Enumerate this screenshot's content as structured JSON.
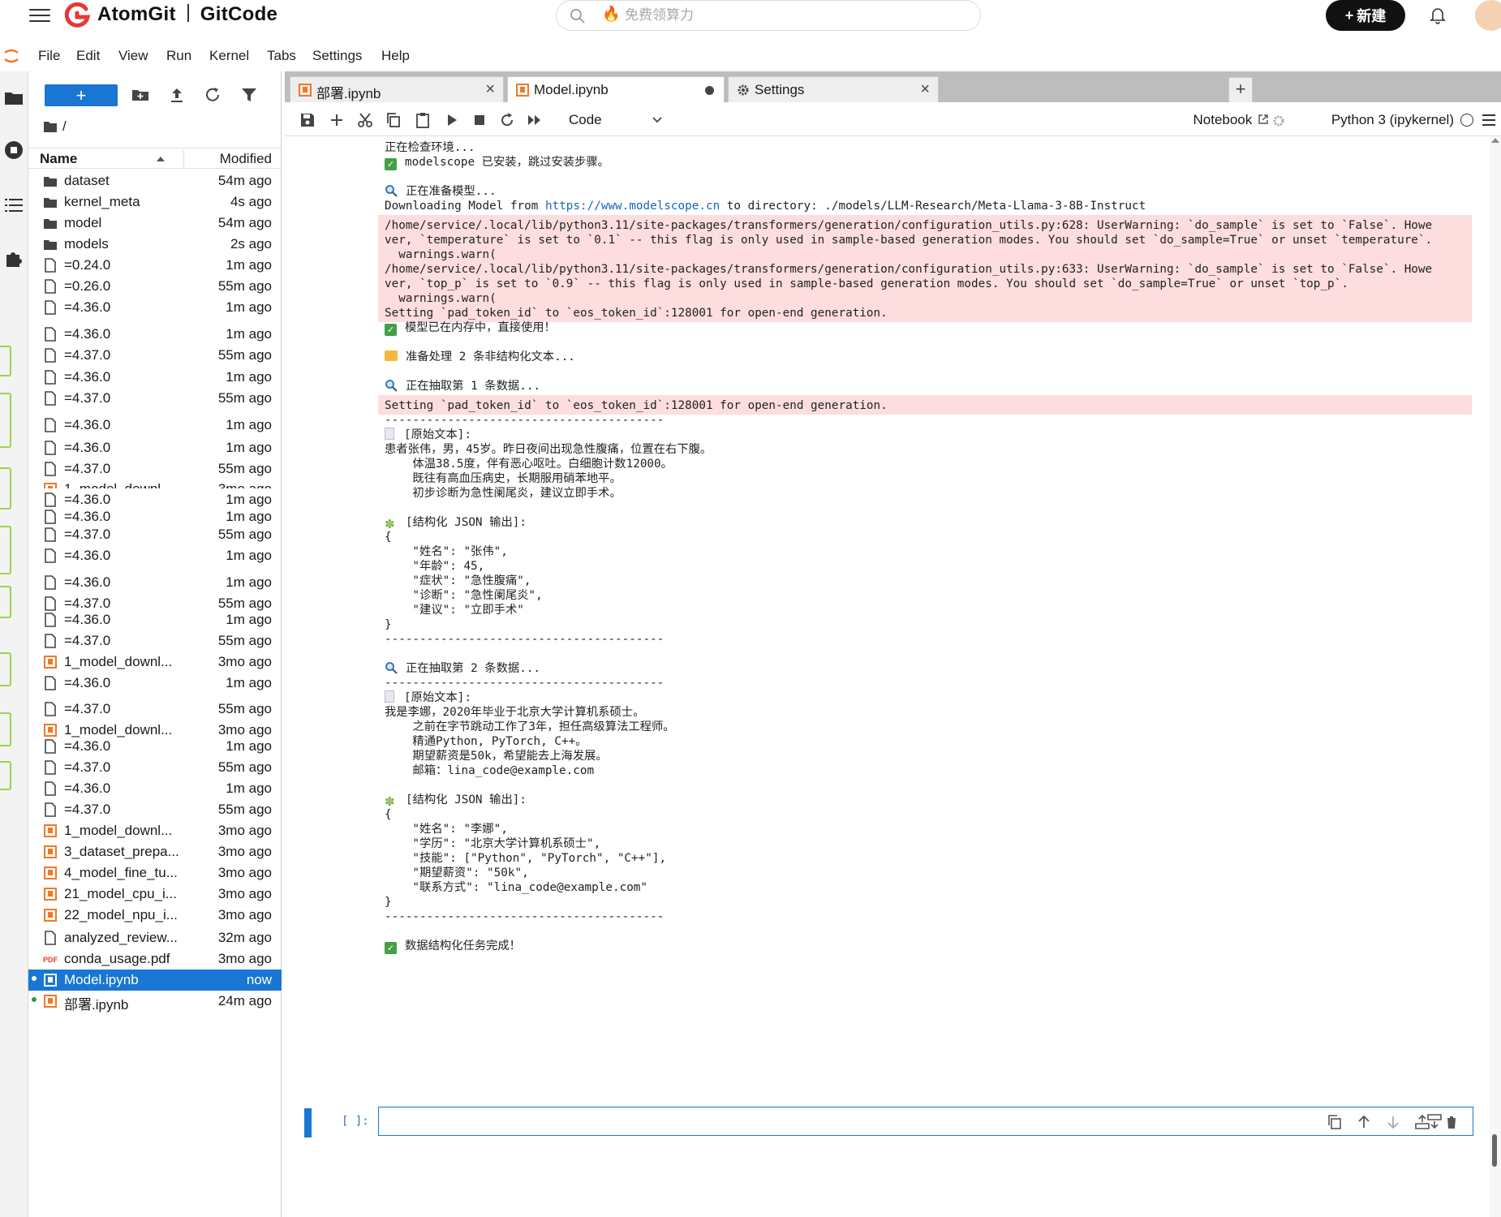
{
  "site": {
    "brand_left": "AtomGit",
    "brand_right": "GitCode",
    "search_placeholder": "免费领算力",
    "new_button": "新建"
  },
  "menu": [
    "File",
    "Edit",
    "View",
    "Run",
    "Kernel",
    "Tabs",
    "Settings",
    "Help"
  ],
  "file_browser": {
    "breadcrumb": "/",
    "col_name": "Name",
    "col_modified": "Modified",
    "rows": [
      {
        "name": "dataset",
        "modified": "54m ago",
        "type": "folder"
      },
      {
        "name": "kernel_meta",
        "modified": "4s ago",
        "type": "folder"
      },
      {
        "name": "model",
        "modified": "54m ago",
        "type": "folder"
      },
      {
        "name": "models",
        "modified": "2s ago",
        "type": "folder"
      },
      {
        "name": "=0.24.0",
        "modified": "1m ago",
        "type": "file"
      },
      {
        "name": "=0.26.0",
        "modified": "55m ago",
        "type": "file"
      },
      {
        "name": "=4.36.0",
        "modified": "1m ago",
        "type": "file"
      },
      {
        "name": "=4.36.0",
        "modified": "1m ago",
        "type": "file"
      },
      {
        "name": "=4.37.0",
        "modified": "55m ago",
        "type": "file"
      },
      {
        "name": "=4.36.0",
        "modified": "1m ago",
        "type": "file"
      },
      {
        "name": "=4.37.0",
        "modified": "55m ago",
        "type": "file"
      },
      {
        "name": "=4.36.0",
        "modified": "1m ago",
        "type": "file"
      },
      {
        "name": "=4.36.0",
        "modified": "1m ago",
        "type": "file"
      },
      {
        "name": "=4.37.0",
        "modified": "55m ago",
        "type": "file"
      },
      {
        "name": "1_model_downl...",
        "modified": "3mo ago",
        "type": "notebook"
      },
      {
        "name": "=4.36.0",
        "modified": "1m ago",
        "type": "file"
      },
      {
        "name": "=4.36.0",
        "modified": "1m ago",
        "type": "file"
      },
      {
        "name": "=4.37.0",
        "modified": "55m ago",
        "type": "file"
      },
      {
        "name": "=4.36.0",
        "modified": "1m ago",
        "type": "file"
      },
      {
        "name": "=4.36.0",
        "modified": "1m ago",
        "type": "file"
      },
      {
        "name": "=4.37.0",
        "modified": "55m ago",
        "type": "file"
      },
      {
        "name": "=4.36.0",
        "modified": "1m ago",
        "type": "file"
      },
      {
        "name": "=4.37.0",
        "modified": "55m ago",
        "type": "file"
      },
      {
        "name": "1_model_downl...",
        "modified": "3mo ago",
        "type": "notebook"
      },
      {
        "name": "=4.36.0",
        "modified": "1m ago",
        "type": "file"
      },
      {
        "name": "=4.37.0",
        "modified": "55m ago",
        "type": "file"
      },
      {
        "name": "1_model_downl...",
        "modified": "3mo ago",
        "type": "notebook"
      },
      {
        "name": "=4.36.0",
        "modified": "1m ago",
        "type": "file"
      },
      {
        "name": "=4.37.0",
        "modified": "55m ago",
        "type": "file"
      },
      {
        "name": "=4.36.0",
        "modified": "1m ago",
        "type": "file"
      },
      {
        "name": "=4.37.0",
        "modified": "55m ago",
        "type": "file"
      },
      {
        "name": "1_model_downl...",
        "modified": "3mo ago",
        "type": "notebook"
      },
      {
        "name": "3_dataset_prepa...",
        "modified": "3mo ago",
        "type": "notebook"
      },
      {
        "name": "4_model_fine_tu...",
        "modified": "3mo ago",
        "type": "notebook"
      },
      {
        "name": "21_model_cpu_i...",
        "modified": "3mo ago",
        "type": "notebook"
      },
      {
        "name": "22_model_npu_i...",
        "modified": "3mo ago",
        "type": "notebook"
      },
      {
        "name": "analyzed_review...",
        "modified": "32m ago",
        "type": "file"
      },
      {
        "name": "conda_usage.pdf",
        "modified": "3mo ago",
        "type": "pdf"
      },
      {
        "name": "Model.ipynb",
        "modified": "now",
        "type": "notebook",
        "selected": true,
        "running": true
      },
      {
        "name": "部署.ipynb",
        "modified": "24m ago",
        "type": "notebook",
        "running": true
      }
    ]
  },
  "tabs": [
    {
      "label": "部署.ipynb",
      "type": "notebook",
      "active": false,
      "dirty": false
    },
    {
      "label": "Model.ipynb",
      "type": "notebook",
      "active": true,
      "dirty": true
    },
    {
      "label": "Settings",
      "type": "settings",
      "active": false,
      "dirty": false
    }
  ],
  "toolbar": {
    "cell_type": "Code",
    "notebook_label": "Notebook",
    "kernel_name": "Python 3 (ipykernel)"
  },
  "output_lines": [
    {
      "text": "正在检查环境..."
    },
    {
      "icon": "check",
      "text": "modelscope 已安装，跳过安装步骤。"
    },
    {
      "text": ""
    },
    {
      "icon": "search",
      "text": "正在准备模型..."
    },
    {
      "text": "Downloading Model from ",
      "url": "https://www.modelscope.cn",
      "suffix": " to directory: ./models/LLM-Research/Meta-Llama-3-8B-Instruct"
    },
    {
      "err": true,
      "text": "/home/service/.local/lib/python3.11/site-packages/transformers/generation/configuration_utils.py:628: UserWarning: `do_sample` is set to `False`. Howe"
    },
    {
      "err": true,
      "text": "ver, `temperature` is set to `0.1` -- this flag is only used in sample-based generation modes. You should set `do_sample=True` or unset `temperature`."
    },
    {
      "err": true,
      "text": "  warnings.warn("
    },
    {
      "err": true,
      "text": "/home/service/.local/lib/python3.11/site-packages/transformers/generation/configuration_utils.py:633: UserWarning: `do_sample` is set to `False`. Howe"
    },
    {
      "err": true,
      "text": "ver, `top_p` is set to `0.9` -- this flag is only used in sample-based generation modes. You should set `do_sample=True` or unset `top_p`."
    },
    {
      "err": true,
      "text": "  warnings.warn("
    },
    {
      "err": true,
      "text": "Setting `pad_token_id` to `eos_token_id`:128001 for open-end generation."
    },
    {
      "icon": "check",
      "text": "模型已在内存中，直接使用！"
    },
    {
      "text": ""
    },
    {
      "icon": "folder",
      "text": "准备处理 2 条非结构化文本..."
    },
    {
      "text": ""
    },
    {
      "icon": "search",
      "text": "正在抽取第 1 条数据..."
    },
    {
      "err": true,
      "text": "Setting `pad_token_id` to `eos_token_id`:128001 for open-end generation."
    },
    {
      "text": "----------------------------------------"
    },
    {
      "icon": "page",
      "text": "[原始文本]:"
    },
    {
      "text": "患者张伟，男，45岁。昨日夜间出现急性腹痛，位置在右下腹。"
    },
    {
      "text": "    体温38.5度，伴有恶心呕吐。白细胞计数12000。"
    },
    {
      "text": "    既往有高血压病史，长期服用硝苯地平。"
    },
    {
      "text": "    初步诊断为急性阑尾炎，建议立即手术。"
    },
    {
      "text": ""
    },
    {
      "icon": "puzzle",
      "text": "[结构化 JSON 输出]:"
    },
    {
      "text": "{"
    },
    {
      "text": "    \"姓名\": \"张伟\","
    },
    {
      "text": "    \"年龄\": 45,"
    },
    {
      "text": "    \"症状\": \"急性腹痛\","
    },
    {
      "text": "    \"诊断\": \"急性阑尾炎\","
    },
    {
      "text": "    \"建议\": \"立即手术\""
    },
    {
      "text": "}"
    },
    {
      "text": "----------------------------------------"
    },
    {
      "text": ""
    },
    {
      "icon": "search",
      "text": "正在抽取第 2 条数据..."
    },
    {
      "text": "----------------------------------------"
    },
    {
      "icon": "page",
      "text": "[原始文本]:"
    },
    {
      "text": "我是李娜，2020年毕业于北京大学计算机系硕士。"
    },
    {
      "text": "    之前在字节跳动工作了3年，担任高级算法工程师。"
    },
    {
      "text": "    精通Python, PyTorch, C++。"
    },
    {
      "text": "    期望薪资是50k，希望能去上海发展。"
    },
    {
      "text": "    邮箱：lina_code@example.com"
    },
    {
      "text": ""
    },
    {
      "icon": "puzzle",
      "text": "[结构化 JSON 输出]:"
    },
    {
      "text": "{"
    },
    {
      "text": "    \"姓名\": \"李娜\","
    },
    {
      "text": "    \"学历\": \"北京大学计算机系硕士\","
    },
    {
      "text": "    \"技能\": [\"Python\", \"PyTorch\", \"C++\"],"
    },
    {
      "text": "    \"期望薪资\": \"50k\","
    },
    {
      "text": "    \"联系方式\": \"lina_code@example.com\""
    },
    {
      "text": "}"
    },
    {
      "text": "----------------------------------------"
    },
    {
      "text": ""
    },
    {
      "icon": "check",
      "text": "数据结构化任务完成！"
    }
  ],
  "empty_cell_prompt": "[ ]:",
  "colors": {
    "accent": "#1976d2",
    "stderr_bg": "#fddddd",
    "brand_red": "#e53935"
  }
}
